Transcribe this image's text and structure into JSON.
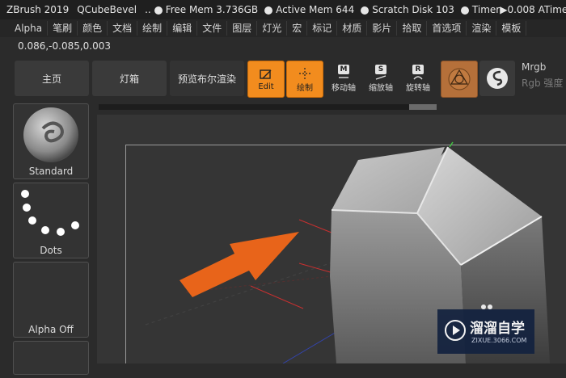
{
  "titlebar": {
    "app": "ZBrush 2019",
    "document": "QCubeBevel",
    "sep": "..",
    "free_mem": "Free Mem 3.736GB",
    "active_mem": "Active Mem 644",
    "scratch_disk": "Scratch Disk 103",
    "timer": "Timer▶0.008 ATime▶"
  },
  "menubar": [
    "Alpha",
    "笔刷",
    "颜色",
    "文档",
    "绘制",
    "编辑",
    "文件",
    "图层",
    "灯光",
    "宏",
    "标记",
    "材质",
    "影片",
    "拾取",
    "首选项",
    "渲染",
    "模板"
  ],
  "coords": "0.086,-0.085,0.003",
  "toolbar": {
    "home": "主页",
    "lightbox": "灯箱",
    "bpr": "预览布尔渲染",
    "edit": "Edit",
    "draw": "绘制",
    "move": "移动轴",
    "scale": "缩放轴",
    "rotate": "旋转轴",
    "move_key": "M",
    "scale_key": "S",
    "rotate_key": "R",
    "mrgb": "Mrgb",
    "rgb_intensity": "Rgb 强度"
  },
  "side": {
    "brush": "Standard",
    "stroke": "Dots",
    "alpha": "Alpha Off"
  },
  "watermark": {
    "title": "溜溜自学",
    "url": "ZIXUE.3066.COM"
  },
  "colors": {
    "accent_orange": "#f28c1e",
    "arrow_orange": "#e8641a",
    "watermark_bg": "#13223f"
  }
}
